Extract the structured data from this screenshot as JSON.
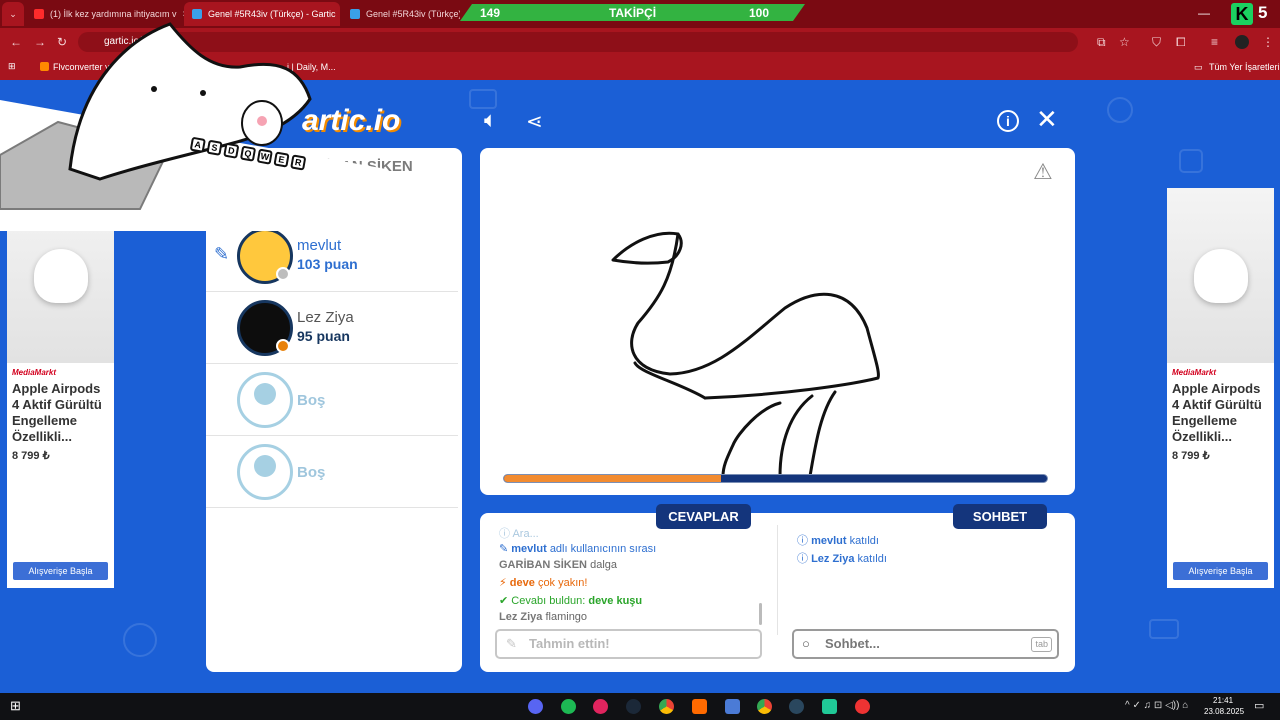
{
  "browser": {
    "tabs": [
      {
        "label": "(1) İlk kez yardımına ihtiyacım v",
        "close": "×"
      },
      {
        "label": "Genel #5R43iv (Türkçe) - Gartic",
        "close": "×"
      },
      {
        "label": "Genel #5R43iv (Türkçe) - G",
        "close": "×"
      }
    ],
    "url": "gartic.io/",
    "bookmarks": [
      "Flvconverter you",
      "…i | Daily, M..."
    ],
    "bookmarks_all": "Tüm Yer İşaretleri"
  },
  "stream_overlay": {
    "follow_current": "149",
    "follow_label": "TAKİPÇİ",
    "follow_goal": "100",
    "logo_letter": "K",
    "logo_number": "5",
    "keyboard_keys": [
      "A",
      "S",
      "D",
      "Q",
      "W",
      "E",
      "R"
    ]
  },
  "game": {
    "logo": "artic.io",
    "players_header": "İBAN SİKEN",
    "players": [
      {
        "name": "mevlut",
        "points": "103 puan",
        "status_color": "#bdbdbd"
      },
      {
        "name": "Lez Ziya",
        "points": "95 puan",
        "status_color": "#e8820c"
      }
    ],
    "empty_slots": [
      "Boş",
      "Boş"
    ],
    "timer_progress": 0.4,
    "tabs": {
      "answers": "CEVAPLAR",
      "chat": "SOHBET"
    },
    "answers": {
      "line0": "Ara...",
      "l1_name": "mevlut",
      "l1_text": "adlı kullanıcının sırası",
      "l2_name": "GARİBAN SİKEN",
      "l2_text": "dalga",
      "l3_word": "deve",
      "l3_text": "çok yakın!",
      "l4_text": "Cevabı buldun:",
      "l4_word": "deve kuşu",
      "l5_name": "Lez Ziya",
      "l5_text": "flamingo"
    },
    "chat": {
      "c1_name": "mevlut",
      "c1_text": "katıldı",
      "c2_name": "Lez Ziya",
      "c2_text": "katıldı"
    },
    "answer_placeholder": "Tahmin ettin!",
    "chat_placeholder": "Sohbet...",
    "tab_hint": "tab"
  },
  "ads": [
    {
      "brand": "MediaMarkt",
      "title": "Apple Airpods 4 Aktif Gürültü Engelleme Özellikli...",
      "price": "8 799 ₺",
      "button": "Alışverişe Başla"
    },
    {
      "brand": "MediaMarkt",
      "title": "Apple Airpods 4 Aktif Gürültü Engelleme Özellikli...",
      "price": "8 799 ₺",
      "button": "Alışverişe Başla"
    }
  ],
  "taskbar": {
    "clock": "21:41",
    "date": "23.08.2025"
  }
}
